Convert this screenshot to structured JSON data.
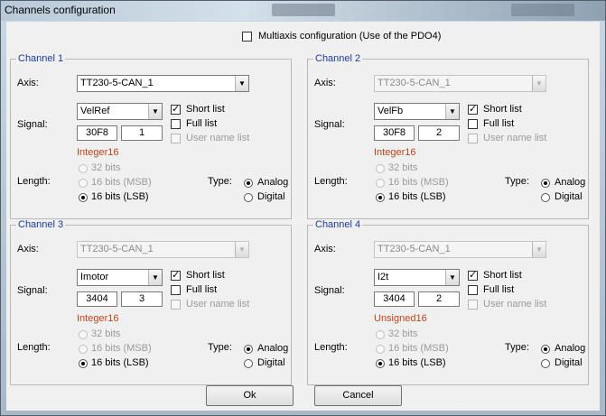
{
  "window": {
    "title": "Channels configuration"
  },
  "multiaxis": {
    "label": "Multiaxis configuration (Use of the PDO4)",
    "checked": false
  },
  "labels": {
    "axis": "Axis:",
    "signal": "Signal:",
    "length": "Length:",
    "type": "Type:",
    "short_list": "Short list",
    "full_list": "Full list",
    "user_name_list": "User name list",
    "bits32": "32 bits",
    "bits16_msb": "16 bits (MSB)",
    "bits16_lsb": "16 bits (LSB)",
    "analog": "Analog",
    "digital": "Digital"
  },
  "channels": [
    {
      "title": "Channel 1",
      "axis": "TT230-5-CAN_1",
      "signal": "VelRef",
      "index": "30F8",
      "subindex": "1",
      "datatype": "Integer16"
    },
    {
      "title": "Channel 2",
      "axis": "TT230-5-CAN_1",
      "signal": "VelFb",
      "index": "30F8",
      "subindex": "2",
      "datatype": "Integer16"
    },
    {
      "title": "Channel 3",
      "axis": "TT230-5-CAN_1",
      "signal": "Imotor",
      "index": "3404",
      "subindex": "3",
      "datatype": "Integer16"
    },
    {
      "title": "Channel 4",
      "axis": "TT230-5-CAN_1",
      "signal": "I2t",
      "index": "3404",
      "subindex": "2",
      "datatype": "Unsigned16"
    }
  ],
  "buttons": {
    "ok": "Ok",
    "cancel": "Cancel"
  },
  "colors": {
    "channel_title": "#1a3a9c",
    "datatype": "#c0441a"
  },
  "icons": {
    "dropdown": "chevron-down-icon",
    "check": "checkmark-icon"
  }
}
